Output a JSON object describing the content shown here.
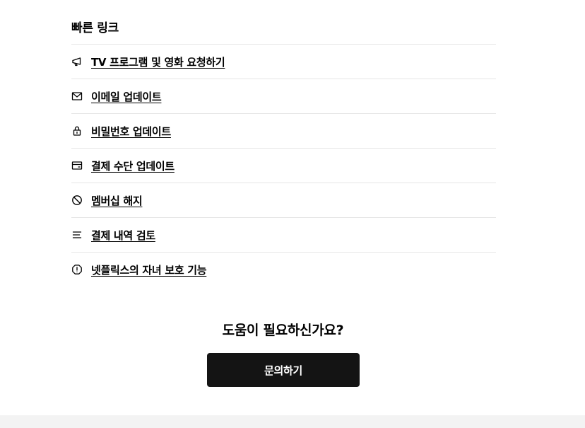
{
  "quick_links": {
    "title": "빠른 링크",
    "items": [
      {
        "label": "TV 프로그램 및 영화 요청하기",
        "icon": "megaphone-icon"
      },
      {
        "label": "이메일 업데이트",
        "icon": "envelope-icon"
      },
      {
        "label": "비밀번호 업데이트",
        "icon": "lock-icon"
      },
      {
        "label": "결제 수단 업데이트",
        "icon": "credit-card-icon"
      },
      {
        "label": "멤버십 해지",
        "icon": "prohibited-icon"
      },
      {
        "label": "결제 내역 검토",
        "icon": "list-icon"
      },
      {
        "label": "넷플릭스의 자녀 보호 기능",
        "icon": "alert-octagon-icon"
      }
    ]
  },
  "help": {
    "title": "도움이 필요하신가요?",
    "contact_label": "문의하기"
  },
  "colors": {
    "button_bg": "#141414",
    "divider": "#e6e6e6",
    "footer_bg": "#f3f3f3"
  }
}
